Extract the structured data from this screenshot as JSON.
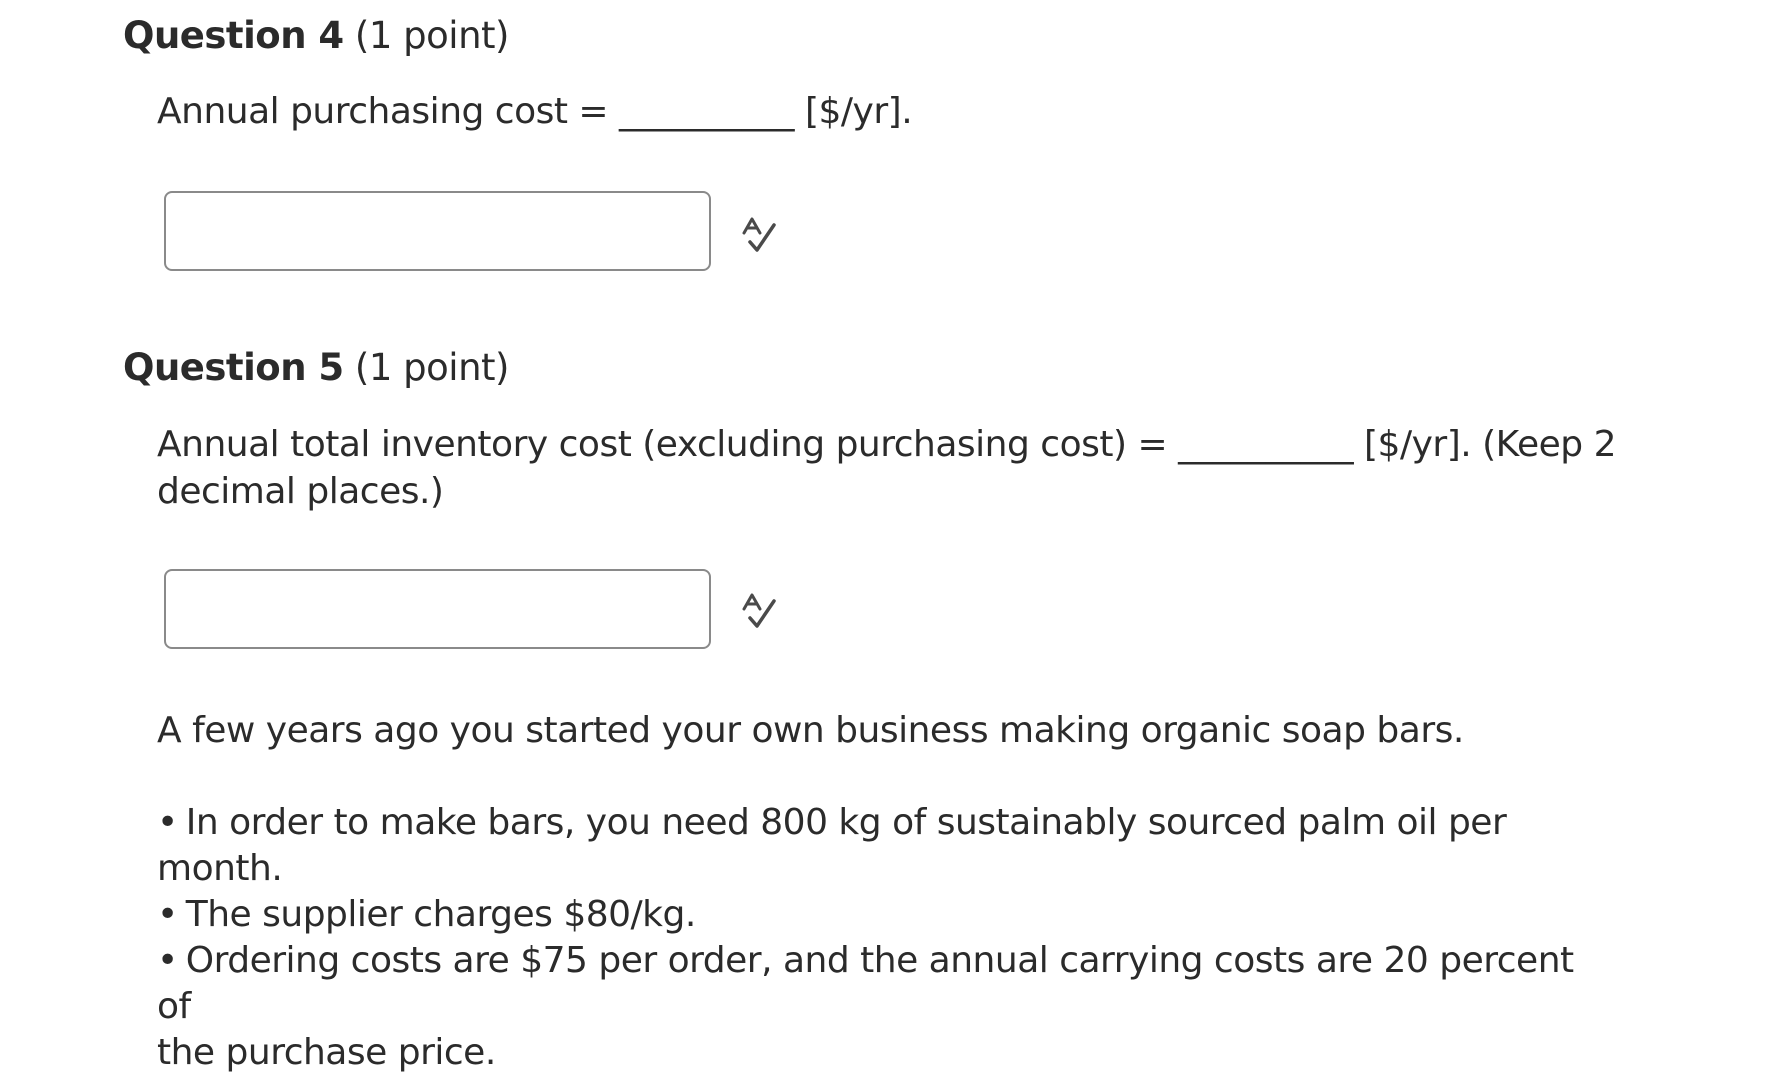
{
  "question4": {
    "title": "Question 4",
    "points": " (1 point)",
    "prompt": "Annual purchasing cost = __________ [$/yr].",
    "answer_value": "",
    "spellcheck_icon": "spellcheck-icon"
  },
  "question5": {
    "title": "Question 5",
    "points": " (1 point)",
    "prompt_line1": "Annual total inventory cost (excluding purchasing cost) = __________ [$/yr]. (Keep 2",
    "prompt_line2": "decimal places.)",
    "answer_value": "",
    "spellcheck_icon": "spellcheck-icon"
  },
  "scenario": {
    "intro": "A few years ago you started your own business making organic soap bars.",
    "bullet_char": "•",
    "bullets": [
      "In order to make bars, you need 800 kg of sustainably sourced palm oil per month.",
      "The supplier charges $80/kg.",
      "Ordering costs are $75 per order, and the annual carrying costs are 20 percent of",
      "the purchase price."
    ]
  }
}
